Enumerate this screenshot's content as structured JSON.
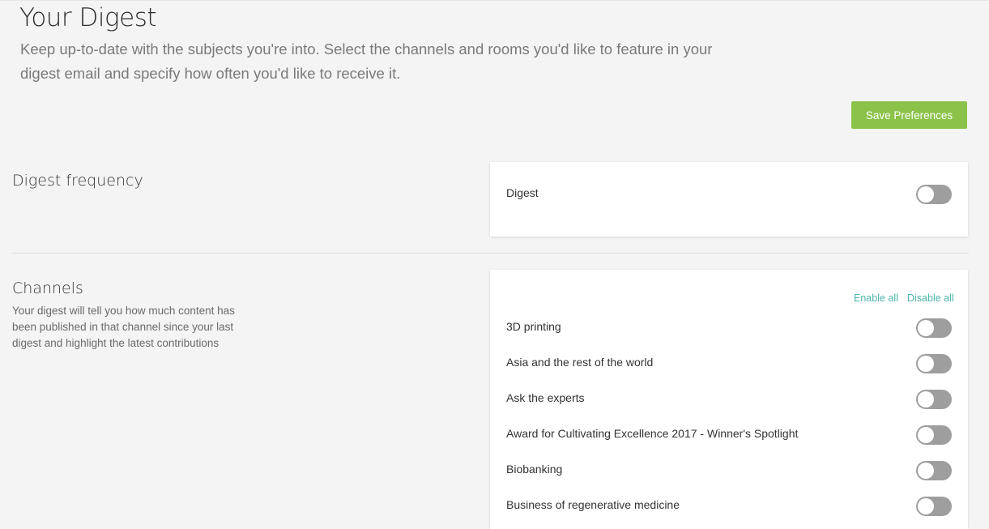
{
  "header": {
    "title": "Your Digest",
    "description": "Keep up-to-date with the subjects you're into. Select the channels and rooms you'd like to feature in your digest email and specify how often you'd like to receive it.",
    "save_label": "Save Preferences"
  },
  "frequency": {
    "title": "Digest frequency",
    "row_label": "Digest",
    "enabled": false
  },
  "channels": {
    "title": "Channels",
    "description": "Your digest will tell you how much content has been published in that channel since your last digest and highlight the latest contributions",
    "enable_all_label": "Enable all",
    "disable_all_label": "Disable all",
    "items": [
      {
        "label": "3D printing",
        "enabled": false
      },
      {
        "label": "Asia and the rest of the world",
        "enabled": false
      },
      {
        "label": "Ask the experts",
        "enabled": false
      },
      {
        "label": "Award for Cultivating Excellence 2017 - Winner's Spotlight",
        "enabled": false
      },
      {
        "label": "Biobanking",
        "enabled": false
      },
      {
        "label": "Business of regenerative medicine",
        "enabled": false
      }
    ]
  },
  "colors": {
    "accent_green": "#8bc34a",
    "link_teal": "#4db6ac",
    "toggle_off": "#9e9e9e"
  }
}
